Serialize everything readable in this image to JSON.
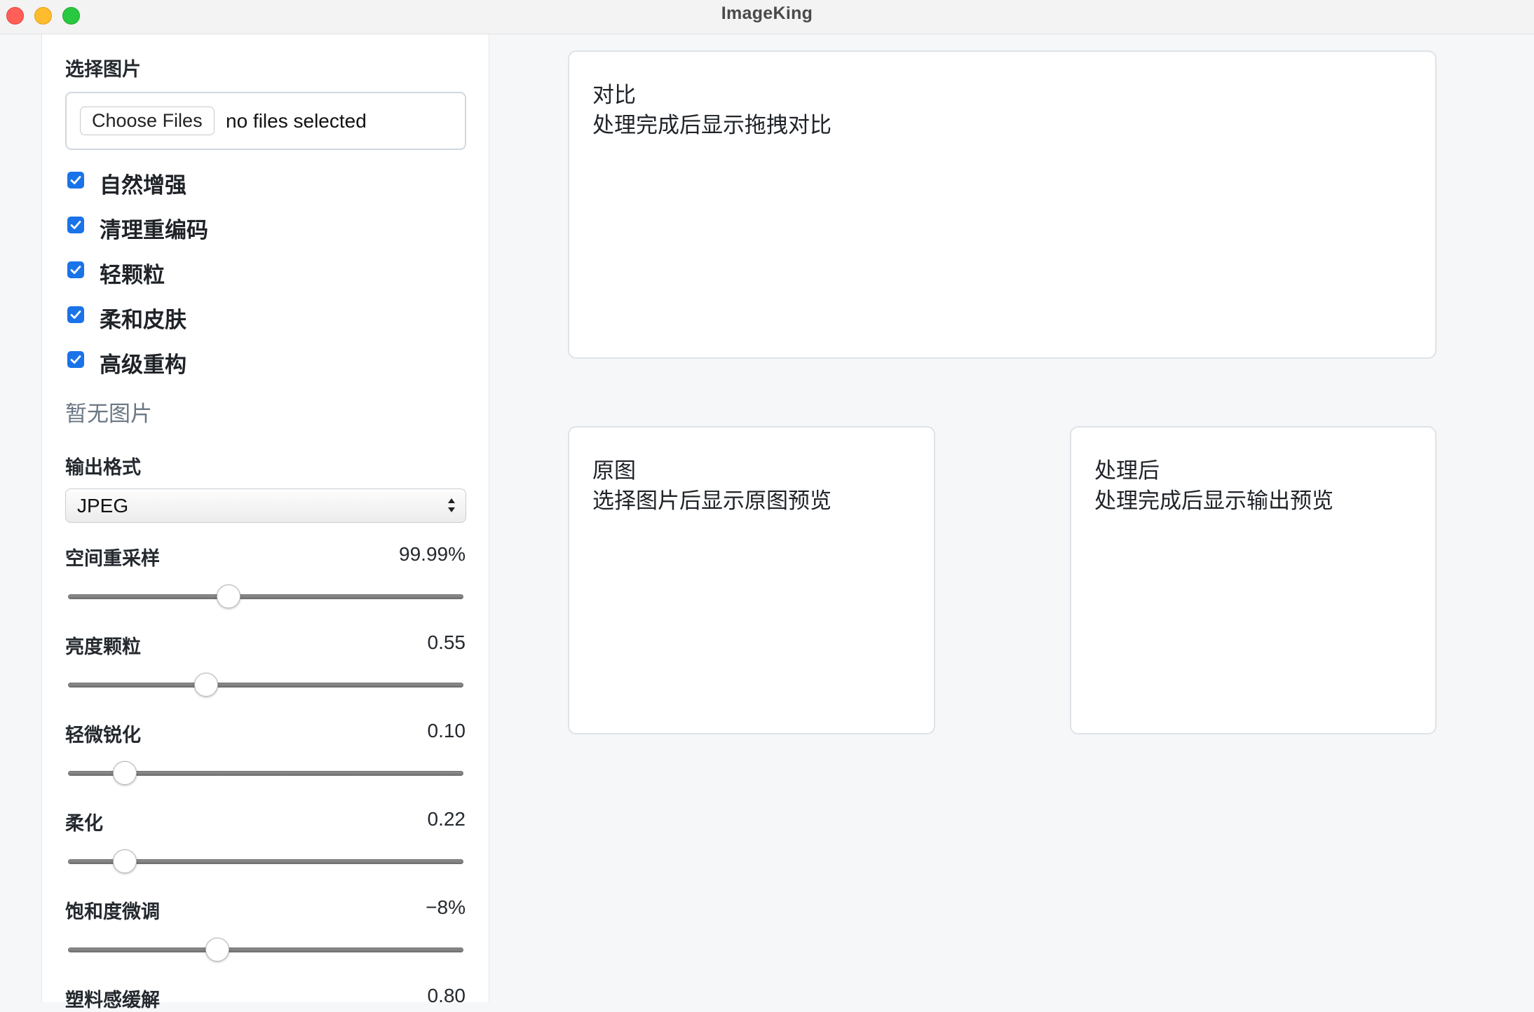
{
  "window": {
    "title": "ImageKing"
  },
  "sidebar": {
    "select_image_label": "选择图片",
    "file_input": {
      "button_label": "Choose Files",
      "status": "no files selected"
    },
    "options": [
      {
        "label": "自然增强",
        "checked": true
      },
      {
        "label": "清理重编码",
        "checked": true
      },
      {
        "label": "轻颗粒",
        "checked": true
      },
      {
        "label": "柔和皮肤",
        "checked": true
      },
      {
        "label": "高级重构",
        "checked": true
      }
    ],
    "no_image_text": "暂无图片",
    "output_format_label": "输出格式",
    "output_format_value": "JPEG",
    "sliders": [
      {
        "label": "空间重采样",
        "value_text": "99.99%",
        "level": 0.4
      },
      {
        "label": "亮度颗粒",
        "value_text": "0.55",
        "level": 0.34
      },
      {
        "label": "轻微锐化",
        "value_text": "0.10",
        "level": 0.12
      },
      {
        "label": "柔化",
        "value_text": "0.22",
        "level": 0.12
      },
      {
        "label": "饱和度微调",
        "value_text": "−8%",
        "level": 0.37
      },
      {
        "label": "塑料感缓解",
        "value_text": "0.80"
      }
    ]
  },
  "panels": {
    "compare": {
      "title": "对比",
      "subtitle": "处理完成后显示拖拽对比"
    },
    "original": {
      "title": "原图",
      "subtitle": "选择图片后显示原图预览"
    },
    "processed": {
      "title": "处理后",
      "subtitle": "处理完成后显示输出预览"
    }
  },
  "colors": {
    "accent": "#1a73e8",
    "background": "#f6f7f9",
    "muted_text": "#6b7785"
  }
}
